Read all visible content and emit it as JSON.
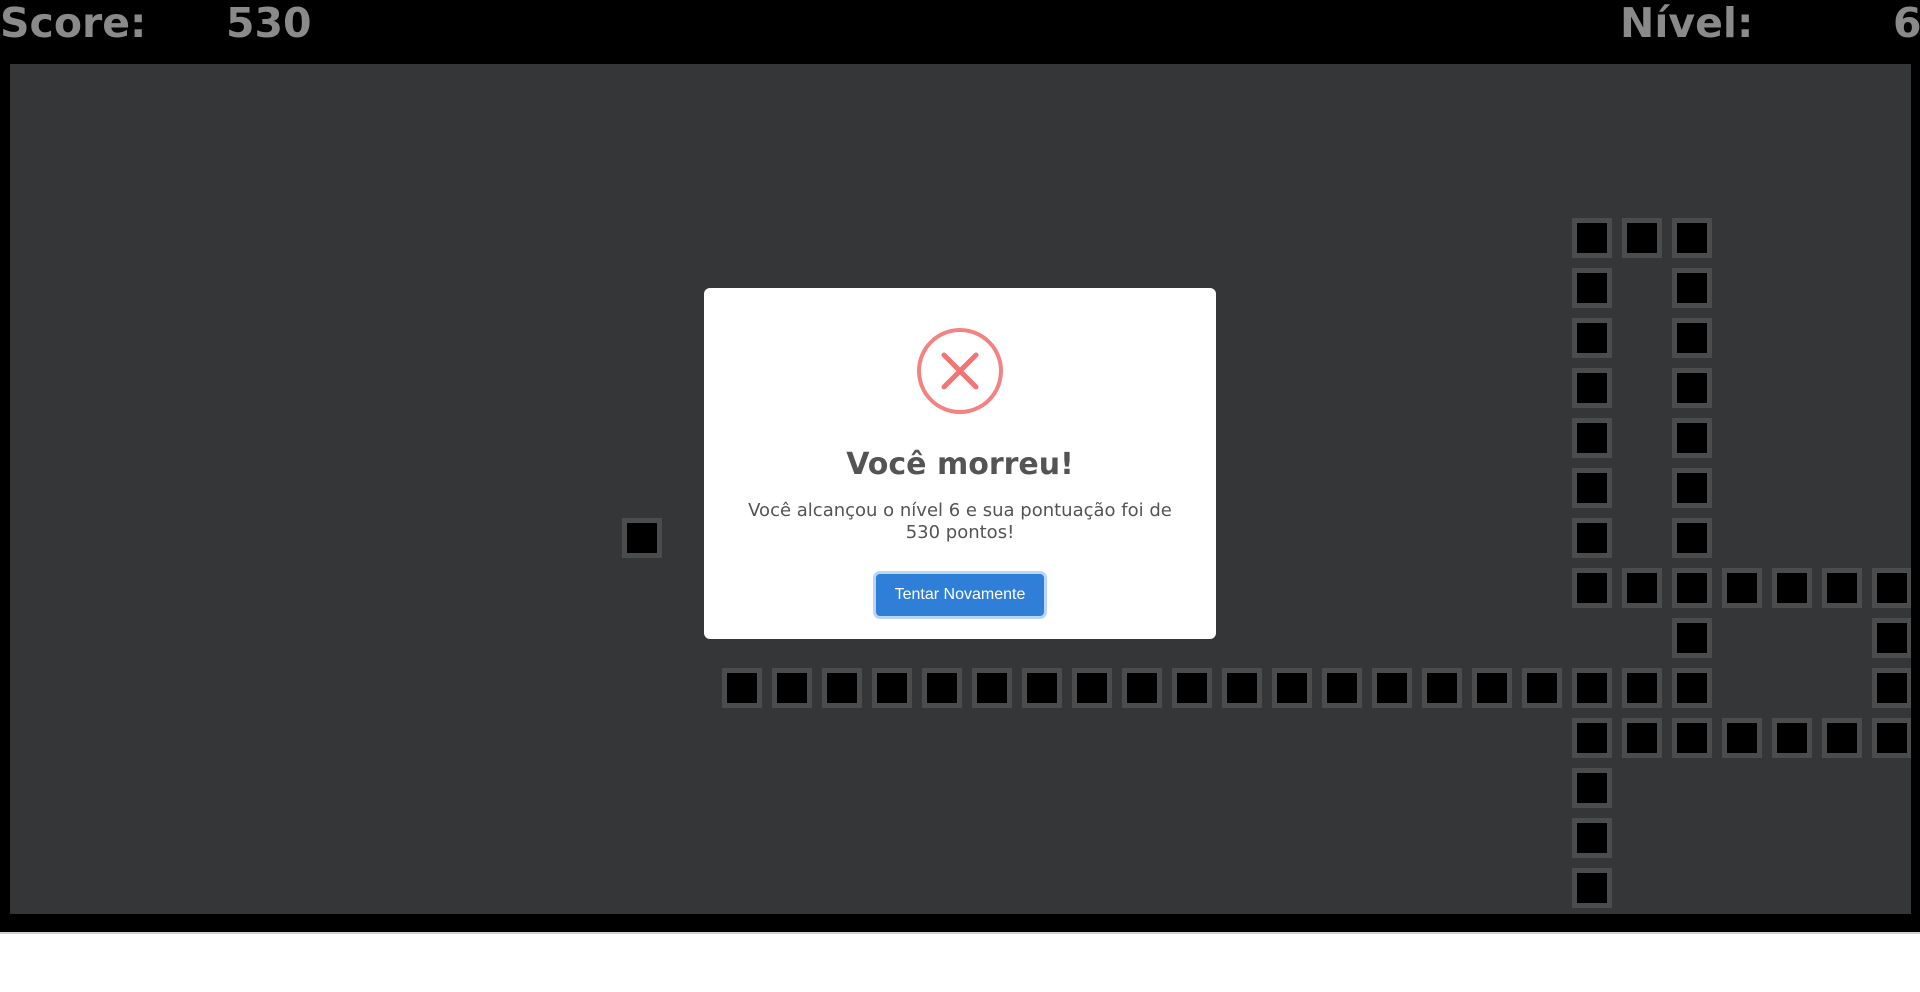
{
  "hud": {
    "score_label": "Score:",
    "score_value": "530",
    "level_label": "Nível:",
    "level_value": "6"
  },
  "board": {
    "background": "#353637",
    "cell_color": "#000000",
    "cell_border": "#4b4c4d",
    "food_cell": [
      12,
      9
    ],
    "snake_cells": [
      [
        31,
        3
      ],
      [
        32,
        3
      ],
      [
        33,
        3
      ],
      [
        31,
        4
      ],
      [
        33,
        4
      ],
      [
        31,
        5
      ],
      [
        33,
        5
      ],
      [
        31,
        6
      ],
      [
        33,
        6
      ],
      [
        31,
        7
      ],
      [
        33,
        7
      ],
      [
        31,
        8
      ],
      [
        33,
        8
      ],
      [
        31,
        9
      ],
      [
        33,
        9
      ],
      [
        31,
        10
      ],
      [
        32,
        10
      ],
      [
        33,
        10
      ],
      [
        34,
        10
      ],
      [
        35,
        10
      ],
      [
        36,
        10
      ],
      [
        37,
        10
      ],
      [
        33,
        11
      ],
      [
        37,
        11
      ],
      [
        14,
        12
      ],
      [
        15,
        12
      ],
      [
        16,
        12
      ],
      [
        17,
        12
      ],
      [
        18,
        12
      ],
      [
        19,
        12
      ],
      [
        20,
        12
      ],
      [
        21,
        12
      ],
      [
        22,
        12
      ],
      [
        23,
        12
      ],
      [
        24,
        12
      ],
      [
        25,
        12
      ],
      [
        26,
        12
      ],
      [
        27,
        12
      ],
      [
        28,
        12
      ],
      [
        29,
        12
      ],
      [
        30,
        12
      ],
      [
        31,
        12
      ],
      [
        32,
        12
      ],
      [
        33,
        12
      ],
      [
        37,
        12
      ],
      [
        31,
        13
      ],
      [
        32,
        13
      ],
      [
        33,
        13
      ],
      [
        34,
        13
      ],
      [
        35,
        13
      ],
      [
        36,
        13
      ],
      [
        37,
        13
      ],
      [
        31,
        14
      ],
      [
        31,
        15
      ],
      [
        31,
        16
      ]
    ]
  },
  "modal": {
    "icon": "error-x-icon",
    "icon_color": "#f27474",
    "title": "Você morreu!",
    "message": "Você alcançou o nível 6 e sua pontuação foi de 530 pontos!",
    "button_label": "Tentar Novamente",
    "button_color": "#2f7fd8"
  }
}
